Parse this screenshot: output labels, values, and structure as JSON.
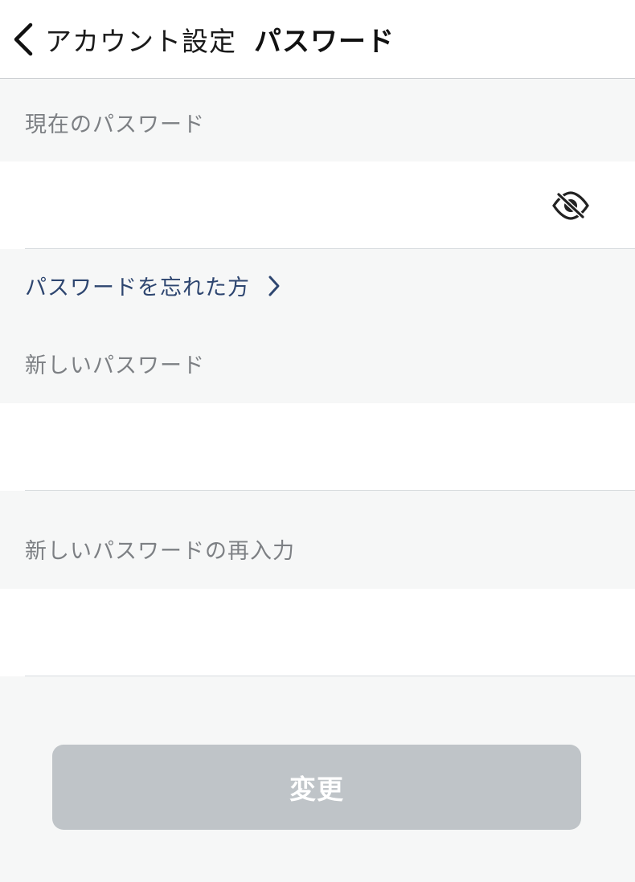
{
  "header": {
    "back_label": "アカウント設定",
    "title": "パスワード"
  },
  "current_password": {
    "label": "現在のパスワード",
    "value": "",
    "visibility_icon": "eye-off-icon"
  },
  "forgot_link": {
    "label": "パスワードを忘れた方"
  },
  "new_password": {
    "label": "新しいパスワード",
    "value": ""
  },
  "confirm_password": {
    "label": "新しいパスワードの再入力",
    "value": ""
  },
  "submit": {
    "label": "変更",
    "state": "disabled"
  },
  "colors": {
    "background": "#f6f7f7",
    "field_background": "#ffffff",
    "label_text": "#7d8084",
    "link_text": "#2e4670",
    "button_disabled": "#bfc4c8"
  }
}
